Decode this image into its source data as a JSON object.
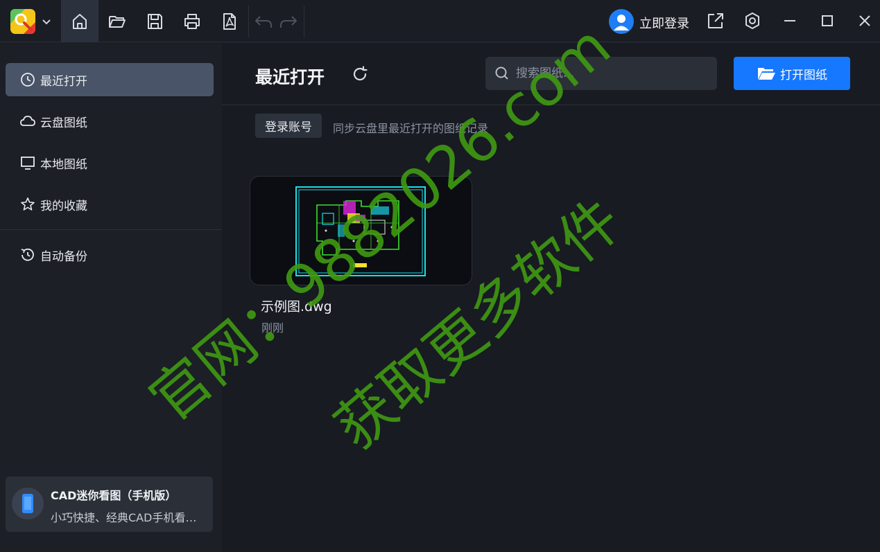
{
  "titlebar": {
    "login_label": "立即登录",
    "toolbar_icons": [
      "home-icon",
      "folder-open-icon",
      "save-icon",
      "print-icon",
      "pdf-icon",
      "undo-icon",
      "redo-icon"
    ],
    "window_icons": [
      "share-icon",
      "settings-icon",
      "minimize-icon",
      "maximize-icon",
      "close-icon"
    ]
  },
  "sidebar": {
    "items": [
      {
        "label": "最近打开",
        "icon": "clock-icon",
        "active": true
      },
      {
        "label": "云盘图纸",
        "icon": "cloud-icon",
        "active": false
      },
      {
        "label": "本地图纸",
        "icon": "monitor-icon",
        "active": false
      },
      {
        "label": "我的收藏",
        "icon": "star-icon",
        "active": false
      },
      {
        "label": "自动备份",
        "icon": "backup-clock-icon",
        "active": false
      }
    ],
    "promo": {
      "title": "CAD迷你看图（手机版）",
      "description": "小巧快捷、经典CAD手机看图软件"
    }
  },
  "main": {
    "title": "最近打开",
    "search_placeholder": "搜索图纸...",
    "open_button": "打开图纸",
    "login_chip": "登录账号",
    "sync_hint": "同步云盘里最近打开的图纸记录",
    "files": [
      {
        "name": "示例图.dwg",
        "time": "刚刚"
      }
    ]
  },
  "watermark": {
    "line1": "官网：9882026.com",
    "line2": "获取更多软件"
  },
  "colors": {
    "accent": "#1677ff",
    "sidebar_active": "#4a5468",
    "watermark": "#3f9a12"
  }
}
